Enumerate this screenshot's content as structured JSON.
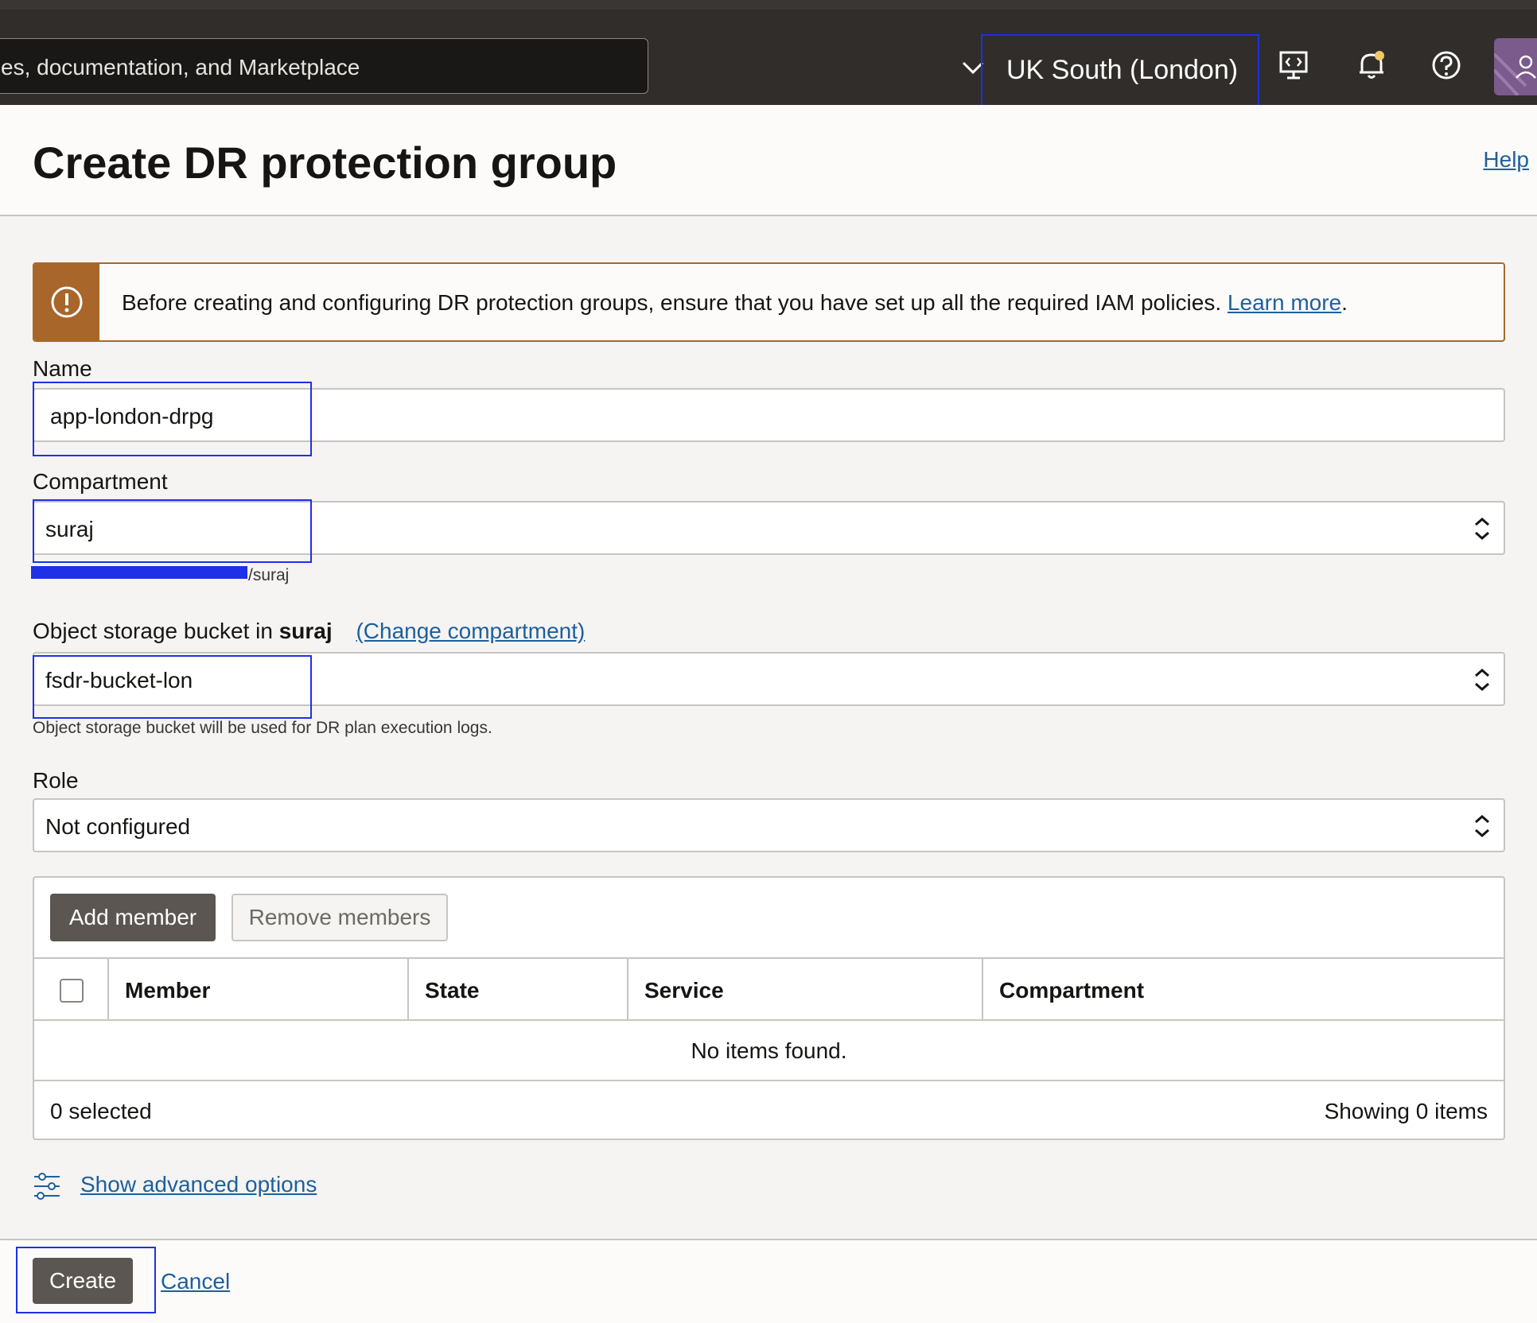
{
  "topbar": {
    "search_placeholder": "es, documentation, and Marketplace",
    "region": "UK South (London)",
    "icons": [
      "chevron-down-icon",
      "developer-tools-icon",
      "bell-icon",
      "help-icon",
      "profile-icon"
    ]
  },
  "header": {
    "title": "Create DR protection group",
    "help": "Help"
  },
  "alert": {
    "text": "Before creating and configuring DR protection groups, ensure that you have set up all the required IAM policies. ",
    "link": "Learn more",
    "suffix": "."
  },
  "form": {
    "name_label": "Name",
    "name_value": "app-london-drpg",
    "compartment_label": "Compartment",
    "compartment_value": "suraj",
    "compartment_path_suffix": "/suraj",
    "bucket_label_prefix": "Object storage bucket in ",
    "bucket_label_compartment": "suraj",
    "bucket_change_link": "(Change compartment)",
    "bucket_value": "fsdr-bucket-lon",
    "bucket_hint": "Object storage bucket will be used for DR plan execution logs.",
    "role_label": "Role",
    "role_value": "Not configured"
  },
  "members": {
    "add_button": "Add member",
    "remove_button": "Remove members",
    "columns": [
      "Member",
      "State",
      "Service",
      "Compartment"
    ],
    "empty_text": "No items found.",
    "selected_text": "0 selected",
    "showing_text": "Showing 0 items"
  },
  "advanced": {
    "link": "Show advanced options"
  },
  "footer": {
    "create": "Create",
    "cancel": "Cancel"
  },
  "colors": {
    "topbar": "#312d2a",
    "highlight": "#1e31e6",
    "alert_accent": "#a8662a",
    "link": "#1e5f9c"
  }
}
